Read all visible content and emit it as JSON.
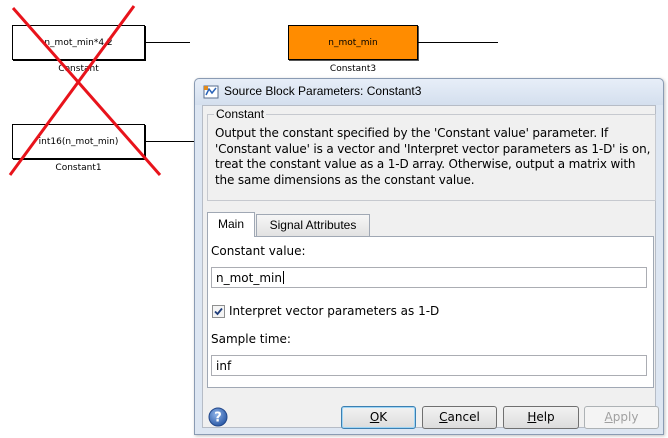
{
  "canvas": {
    "blocks": [
      {
        "label": "n_mot_min*4.2",
        "caption": "Constant"
      },
      {
        "label": "n_mot_min",
        "caption": "Constant3",
        "color": "#ff8c00"
      },
      {
        "label": "int16(n_mot_min)",
        "caption": "Constant1"
      }
    ],
    "cross_color": "#e8131b"
  },
  "dialog": {
    "title": "Source Block Parameters: Constant3",
    "group_title": "Constant",
    "description": "Output the constant specified by the 'Constant value' parameter. If 'Constant value' is a vector and 'Interpret vector parameters as 1-D' is on, treat the constant value as a 1-D array. Otherwise, output a matrix with the same dimensions as the constant value.",
    "tabs": [
      {
        "label": "Main",
        "active": true
      },
      {
        "label": "Signal Attributes",
        "active": false
      }
    ],
    "constant_value_label": "Constant value:",
    "constant_value": "n_mot_min",
    "interpret_checkbox_label": "Interpret vector parameters as 1-D",
    "interpret_checked": true,
    "sample_time_label": "Sample time:",
    "sample_time": "inf",
    "buttons": {
      "ok": {
        "label": "OK",
        "mnemonic": "O"
      },
      "cancel": {
        "label": "Cancel",
        "mnemonic": "C"
      },
      "help": {
        "label": "Help",
        "mnemonic": "H"
      },
      "apply": {
        "label": "Apply",
        "mnemonic": "A",
        "disabled": true
      }
    }
  }
}
